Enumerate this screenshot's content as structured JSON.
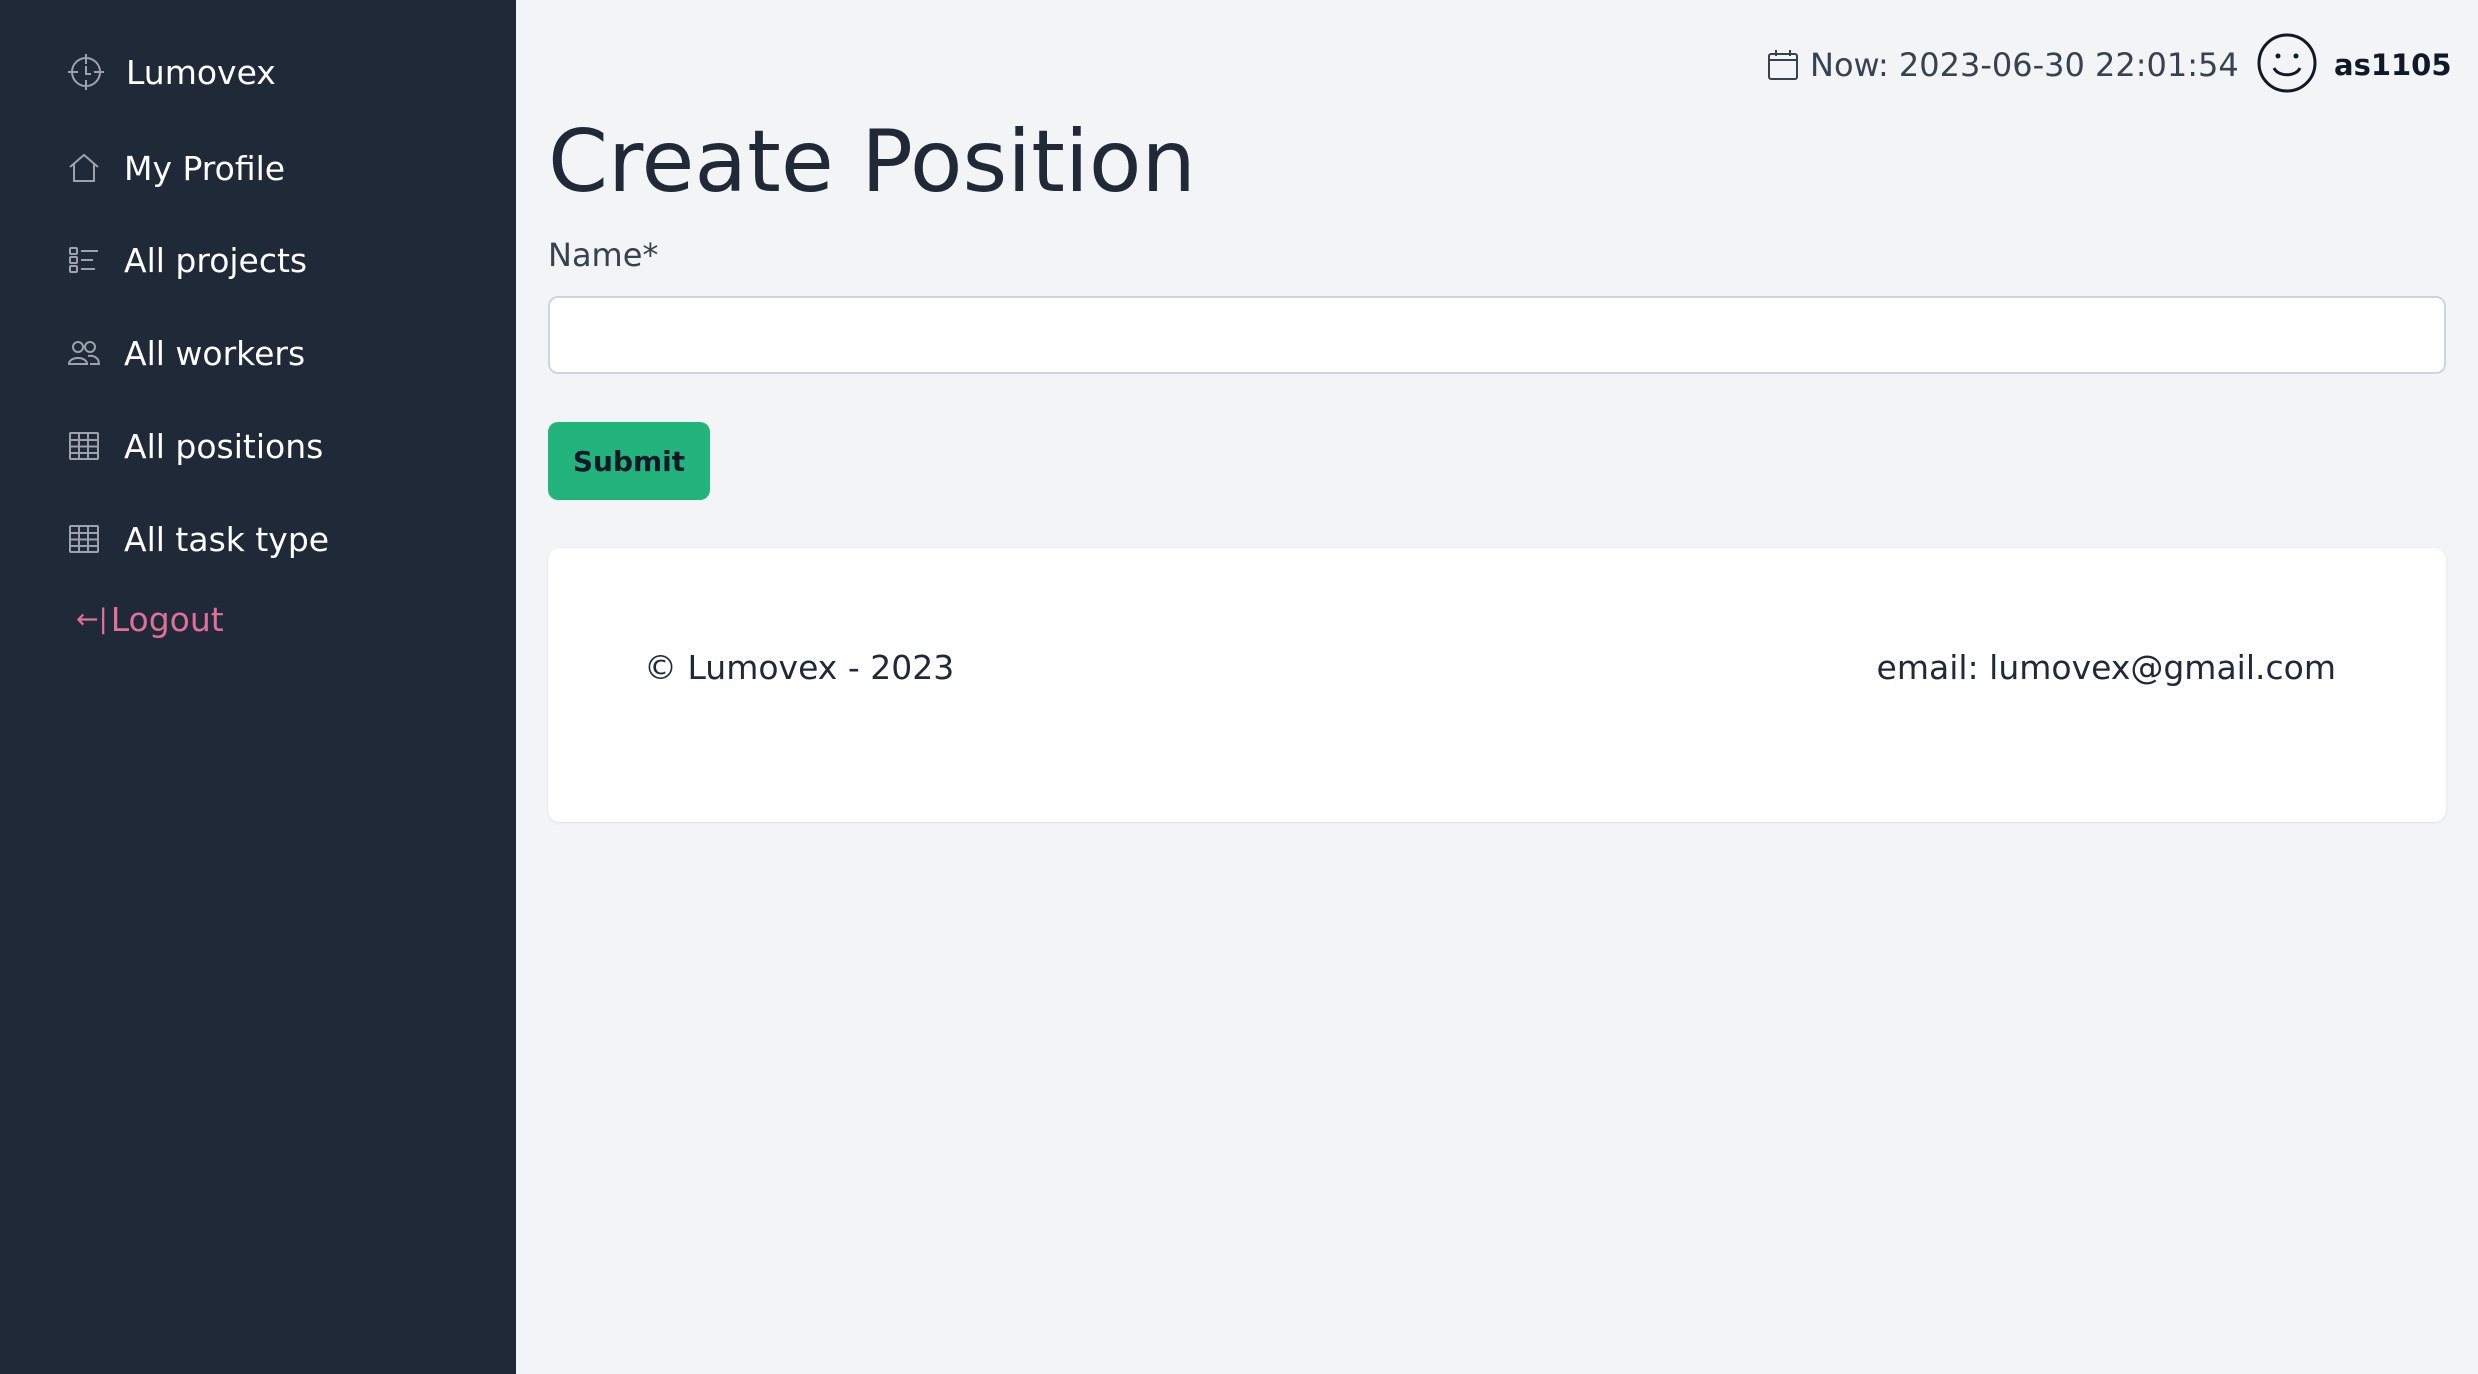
{
  "sidebar": {
    "brand": "Lumovex",
    "items": [
      {
        "label": "My Profile",
        "icon": "home-icon"
      },
      {
        "label": "All projects",
        "icon": "checklist-icon"
      },
      {
        "label": "All workers",
        "icon": "users-icon"
      },
      {
        "label": "All positions",
        "icon": "table-icon"
      },
      {
        "label": "All task type",
        "icon": "table-icon"
      }
    ],
    "logout_arrow": "←|",
    "logout_label": "Logout"
  },
  "header": {
    "date_text": "Now: 2023-06-30 22:01:54",
    "username": "as1105"
  },
  "main": {
    "title": "Create Position",
    "name_label": "Name*",
    "name_value": "",
    "name_placeholder": "",
    "submit_label": "Submit"
  },
  "footer": {
    "copyright": "© Lumovex - 2023",
    "email": "email: lumovex@gmail.com"
  },
  "colors": {
    "sidebar_bg": "#1f2937",
    "page_bg": "#f3f4f6",
    "accent": "#22b47c",
    "logout": "#e0709a"
  }
}
